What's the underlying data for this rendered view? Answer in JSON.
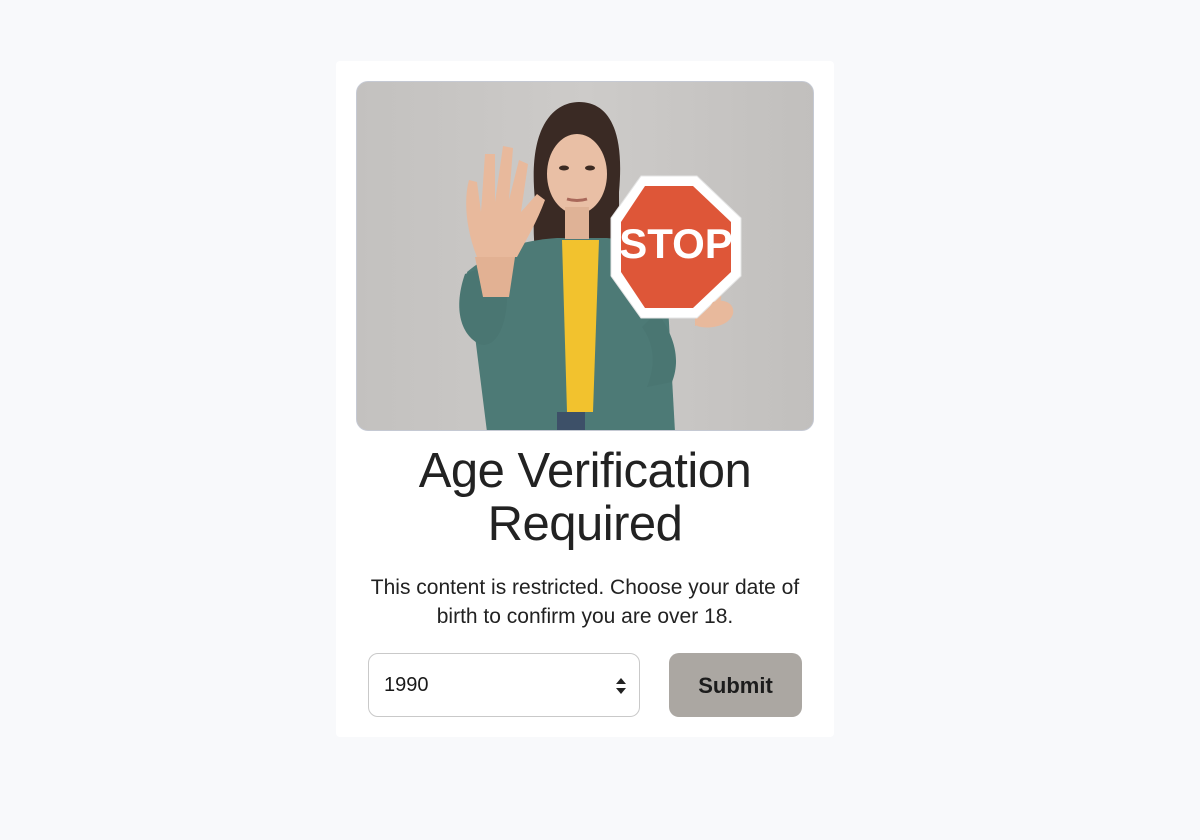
{
  "card": {
    "title": "Age Verification Required",
    "description": "This content is restricted. Choose your date of birth to confirm you are over 18.",
    "hero_sign_text": "STOP",
    "year_select": {
      "value": "1990"
    },
    "submit_label": "Submit"
  },
  "colors": {
    "page_background": "#f8f9fb",
    "card_background": "#ffffff",
    "submit_button": "#aba7a2",
    "stop_sign": "#de5638"
  }
}
